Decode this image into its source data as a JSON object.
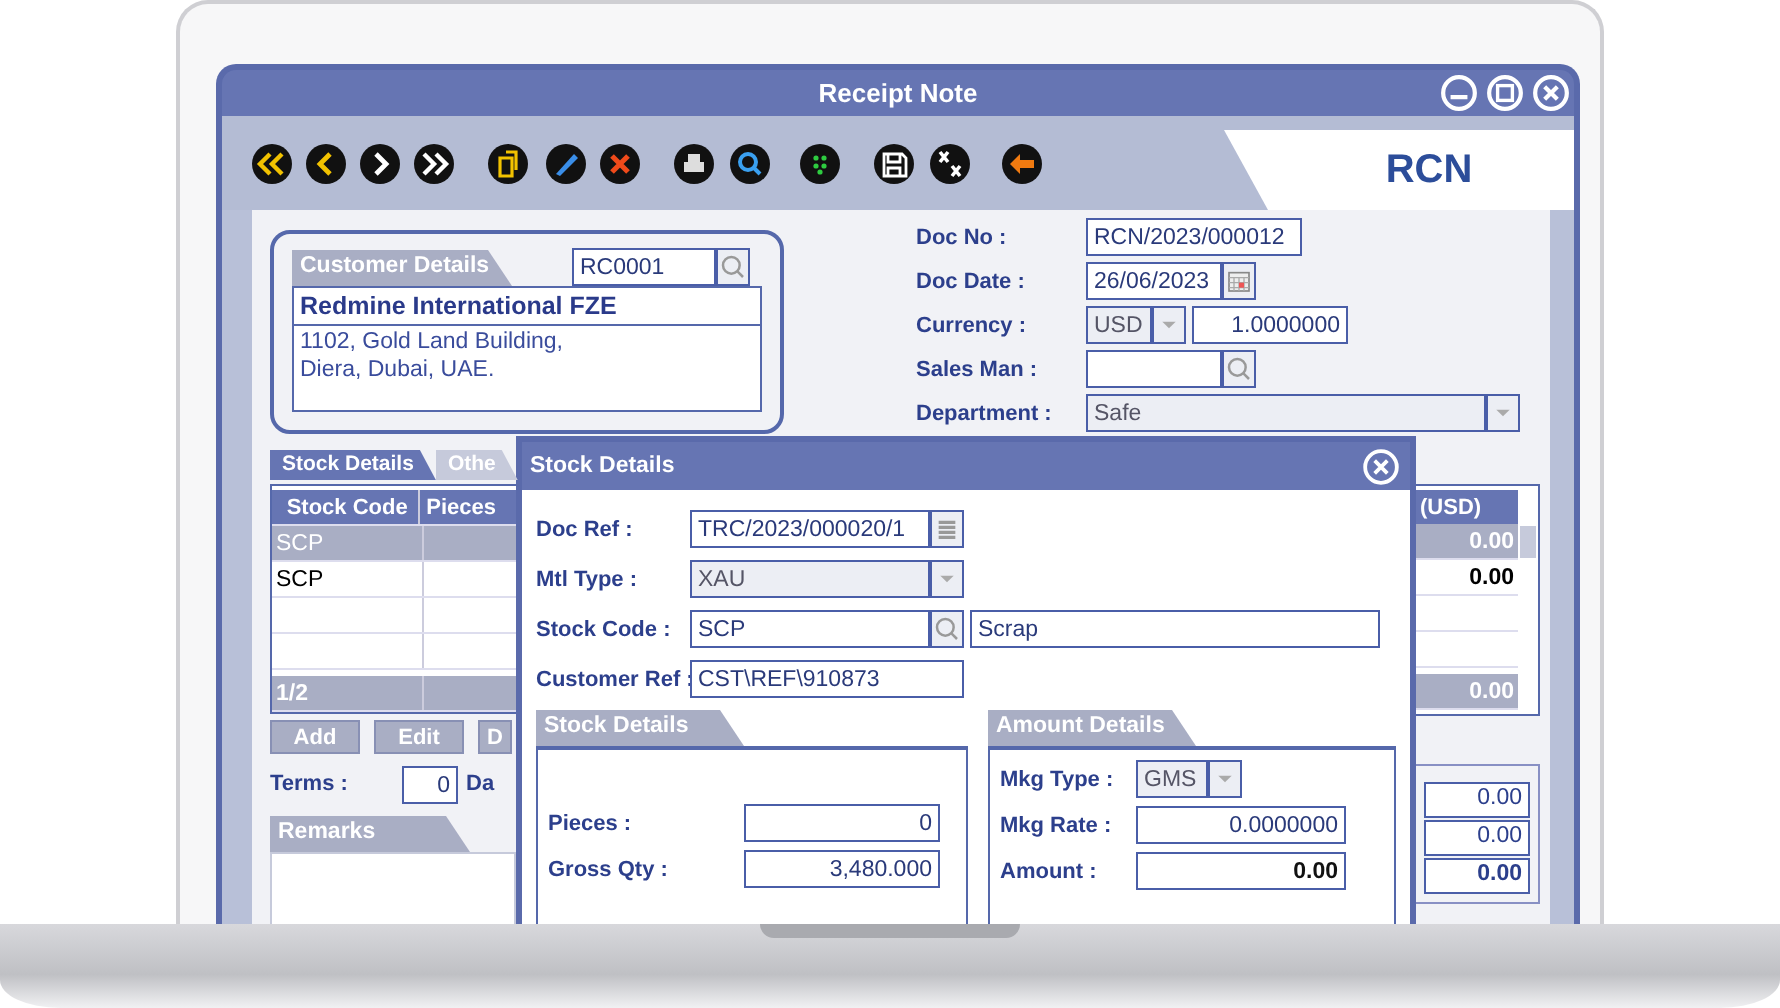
{
  "window": {
    "title": "Receipt Note"
  },
  "toolbar": {
    "badge": "RCN"
  },
  "customer": {
    "tab": "Customer Details",
    "code": "RC0001",
    "name": "Redmine International FZE",
    "address": [
      "1102, Gold Land Building,",
      "Diera, Dubai, UAE."
    ]
  },
  "header_fields": [
    {
      "label": "Doc No :",
      "value": "RCN/2023/000012",
      "kind": "text"
    },
    {
      "label": "Doc Date :",
      "value": "26/06/2023",
      "kind": "date"
    },
    {
      "label": "Currency :",
      "value": "USD",
      "rate": "1.0000000",
      "kind": "currency"
    },
    {
      "label": "Sales Man :",
      "kind": "lookup"
    },
    {
      "label": "Department :",
      "value": "Safe",
      "kind": "select"
    }
  ],
  "detail_tabs": [
    {
      "label": "Stock Details",
      "selected": true
    },
    {
      "label": "Othe",
      "selected": false
    }
  ],
  "grid": {
    "columns": [
      "Stock Code",
      "Pieces"
    ],
    "amount_column": "(USD)",
    "rows": [
      {
        "code": "SCP",
        "amount": "0.00",
        "selected": true
      },
      {
        "code": "SCP",
        "amount": "0.00",
        "selected": false
      },
      {
        "selected": false
      },
      {
        "selected": false
      }
    ],
    "footer": "1/2",
    "footer_amount": "0.00"
  },
  "grid_buttons": [
    "Add",
    "Edit",
    "D"
  ],
  "terms": {
    "label": "Terms :",
    "value": "0",
    "unit": "Da"
  },
  "remarks": {
    "tab": "Remarks"
  },
  "totals": [
    {
      "value": "0.00",
      "bold": false
    },
    {
      "value": "0.00",
      "bold": false
    },
    {
      "value": "0.00",
      "bold": true
    }
  ],
  "dialog": {
    "title": "Stock Details",
    "fields": [
      {
        "label": "Doc Ref :",
        "value": "TRC/2023/000020/1",
        "kind": "list"
      },
      {
        "label": "Mtl Type :",
        "value": "XAU",
        "kind": "select"
      },
      {
        "label": "Stock Code :",
        "value": "SCP",
        "description": "Scrap",
        "kind": "lookup"
      },
      {
        "label": "Customer Ref :",
        "value": "CST\\REF\\910873",
        "kind": "text"
      }
    ],
    "stock_panel": {
      "tab": "Stock Details",
      "fields": [
        {
          "label": "Pieces :",
          "value": "0"
        },
        {
          "label": "Gross Qty :",
          "value": "3,480.000"
        }
      ]
    },
    "amount_panel": {
      "tab": "Amount Details",
      "fields": [
        {
          "label": "Mkg Type :",
          "value": "GMS",
          "kind": "select",
          "bold": false
        },
        {
          "label": "Mkg Rate :",
          "value": "0.0000000",
          "kind": "number",
          "bold": false
        },
        {
          "label": "Amount :",
          "value": "0.00",
          "kind": "number",
          "bold": true
        }
      ]
    }
  }
}
